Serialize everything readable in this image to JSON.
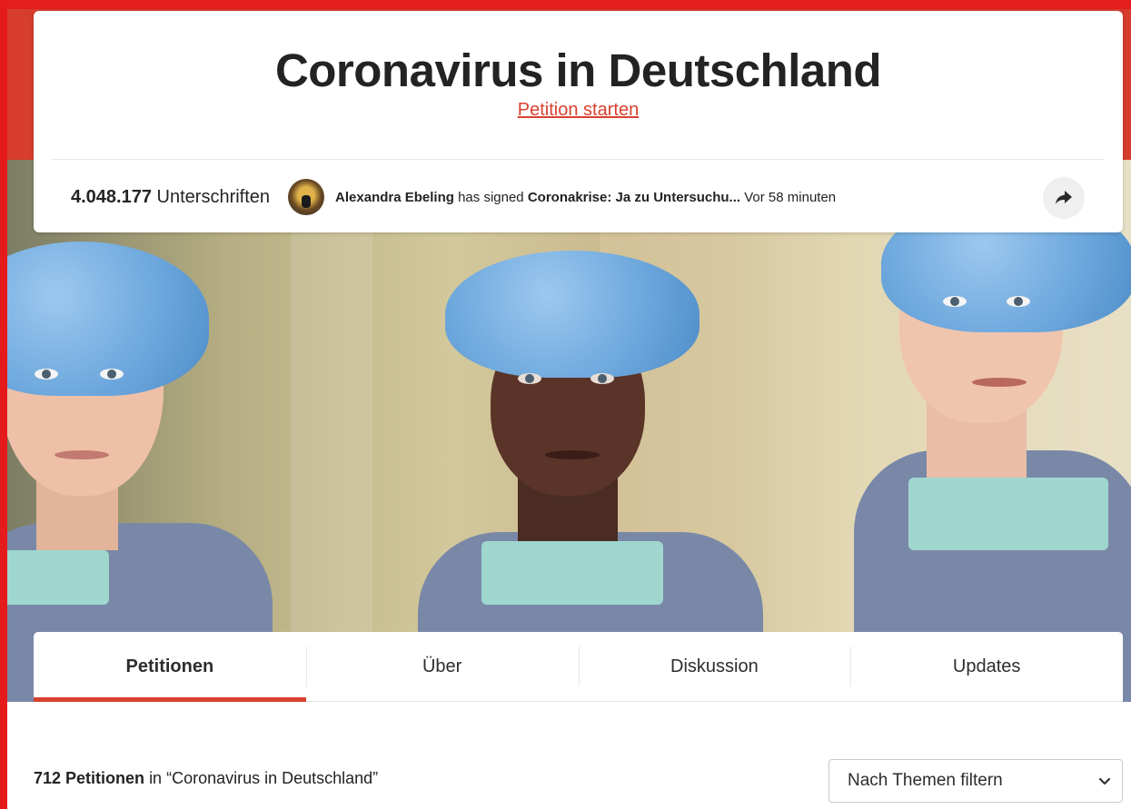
{
  "header": {
    "title": "Coronavirus in Deutschland",
    "start_petition_link": "Petition starten"
  },
  "signatures": {
    "count": "4.048.177",
    "label": "Unterschriften"
  },
  "activity": {
    "signer_name": "Alexandra Ebeling",
    "verb": "has signed",
    "petition_title": "Coronakrise: Ja zu Untersuchu...",
    "time_ago": "Vor 58 minuten"
  },
  "tabs": [
    {
      "label": "Petitionen",
      "active": true
    },
    {
      "label": "Über",
      "active": false
    },
    {
      "label": "Diskussion",
      "active": false
    },
    {
      "label": "Updates",
      "active": false
    }
  ],
  "results": {
    "count_bold": "712 Petitionen",
    "suffix": "in “Coronavirus in Deutschland”"
  },
  "filter": {
    "selected": "Nach Themen filtern"
  },
  "icons": {
    "share": "share-arrow-icon",
    "dropdown": "chevron-down-icon"
  },
  "colors": {
    "brand_red": "#d8412f",
    "top_band": "#d63d2d"
  }
}
